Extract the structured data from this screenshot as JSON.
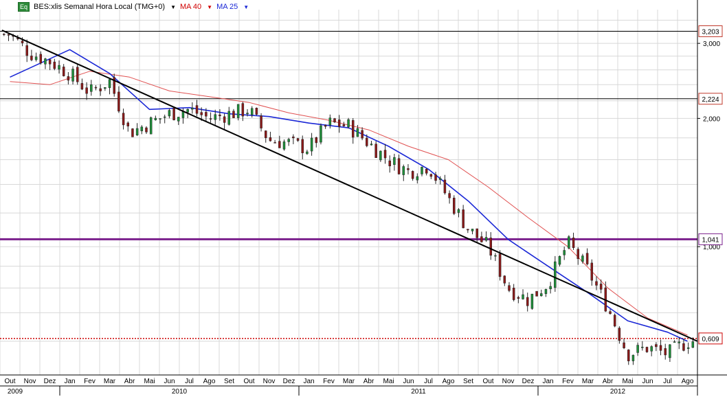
{
  "header": {
    "badge": "Eq",
    "symbol_label": "BES:xlis Semanal Hora Local (TMG+0)",
    "ma40_label": "MA 40",
    "ma25_label": "MA 25"
  },
  "colors": {
    "candle_up": "#1e8f3a",
    "candle_down": "#8b1a1a",
    "ma40": "#e05050",
    "ma25": "#1a27d6",
    "trendline": "#000000",
    "support_1041": "#7a1f8c",
    "support_0609": "#cc0000",
    "grid": "#d8d8d8"
  },
  "chart_data": {
    "type": "candlestick",
    "y_scale": "log",
    "ylim": [
      0.5,
      3.6
    ],
    "y_ticks": [
      "3,000",
      "2,000",
      "1,000"
    ],
    "x_months": [
      "Out",
      "Nov",
      "Dez",
      "Jan",
      "Fev",
      "Mar",
      "Abr",
      "Mai",
      "Jun",
      "Jul",
      "Ago",
      "Set",
      "Out",
      "Nov",
      "Dez",
      "Jan",
      "Fev",
      "Mar",
      "Abr",
      "Mai",
      "Jun",
      "Jul",
      "Ago",
      "Set",
      "Out",
      "Nov",
      "Dez",
      "Jan",
      "Fev",
      "Mar",
      "Abr",
      "Mai",
      "Jun",
      "Jul",
      "Ago"
    ],
    "x_years": [
      "2009",
      "2010",
      "2011",
      "2012"
    ],
    "year_start_month_index": [
      0,
      3,
      15,
      27
    ],
    "period": {
      "start": "2009-10",
      "end": "2012-08",
      "frequency": "weekly"
    },
    "horizontal_lines": [
      {
        "value": 3.203,
        "label": "3,203",
        "style": "solid",
        "color": "#000000"
      },
      {
        "value": 2.224,
        "label": "2,224",
        "style": "solid",
        "color": "#000000"
      },
      {
        "value": 1.041,
        "label": "1,041",
        "style": "solid-thick",
        "color": "#7a1f8c"
      },
      {
        "value": 0.609,
        "label": "0,609",
        "style": "dotted",
        "color": "#cc0000"
      }
    ],
    "trendline": {
      "from": {
        "date": "2009-10",
        "value": 3.22
      },
      "to": {
        "date": "2012-08",
        "value": 0.6
      }
    },
    "anchors": [
      [
        "2009-10",
        3.15
      ],
      [
        "2009-11",
        2.85
      ],
      [
        "2009-12",
        2.72
      ],
      [
        "2010-01",
        2.55
      ],
      [
        "2010-02",
        2.3
      ],
      [
        "2010-03",
        2.45
      ],
      [
        "2010-04",
        1.85
      ],
      [
        "2010-05",
        1.95
      ],
      [
        "2010-06",
        2.05
      ],
      [
        "2010-07",
        2.1
      ],
      [
        "2010-08",
        2.0
      ],
      [
        "2010-09",
        2.05
      ],
      [
        "2010-10",
        2.1
      ],
      [
        "2010-11",
        1.78
      ],
      [
        "2010-12",
        1.75
      ],
      [
        "2011-01",
        1.7
      ],
      [
        "2011-02",
        1.95
      ],
      [
        "2011-03",
        1.92
      ],
      [
        "2011-04",
        1.75
      ],
      [
        "2011-05",
        1.6
      ],
      [
        "2011-06",
        1.5
      ],
      [
        "2011-07",
        1.55
      ],
      [
        "2011-08",
        1.3
      ],
      [
        "2011-09",
        1.1
      ],
      [
        "2011-10",
        1.0
      ],
      [
        "2011-11",
        0.8
      ],
      [
        "2011-12",
        0.75
      ],
      [
        "2012-01",
        0.82
      ],
      [
        "2012-02",
        1.02
      ],
      [
        "2012-03",
        0.88
      ],
      [
        "2012-04",
        0.72
      ],
      [
        "2012-05",
        0.56
      ],
      [
        "2012-06",
        0.58
      ],
      [
        "2012-07",
        0.56
      ],
      [
        "2012-08",
        0.6
      ]
    ],
    "ma25_anchors": [
      [
        "2009-10",
        2.5
      ],
      [
        "2010-01",
        2.9
      ],
      [
        "2010-03",
        2.55
      ],
      [
        "2010-05",
        2.1
      ],
      [
        "2010-07",
        2.12
      ],
      [
        "2010-09",
        2.05
      ],
      [
        "2010-11",
        2.02
      ],
      [
        "2011-01",
        1.95
      ],
      [
        "2011-03",
        1.9
      ],
      [
        "2011-05",
        1.72
      ],
      [
        "2011-07",
        1.52
      ],
      [
        "2011-09",
        1.28
      ],
      [
        "2011-11",
        1.04
      ],
      [
        "2012-01",
        0.9
      ],
      [
        "2012-03",
        0.78
      ],
      [
        "2012-05",
        0.67
      ],
      [
        "2012-07",
        0.63
      ],
      [
        "2012-08",
        0.6
      ]
    ],
    "ma40_anchors": [
      [
        "2009-10",
        2.44
      ],
      [
        "2009-12",
        2.4
      ],
      [
        "2010-02",
        2.58
      ],
      [
        "2010-04",
        2.5
      ],
      [
        "2010-06",
        2.32
      ],
      [
        "2010-08",
        2.25
      ],
      [
        "2010-10",
        2.18
      ],
      [
        "2010-12",
        2.06
      ],
      [
        "2011-02",
        1.98
      ],
      [
        "2011-04",
        1.88
      ],
      [
        "2011-06",
        1.72
      ],
      [
        "2011-08",
        1.6
      ],
      [
        "2011-10",
        1.38
      ],
      [
        "2011-12",
        1.17
      ],
      [
        "2012-02",
        1.0
      ],
      [
        "2012-04",
        0.8
      ],
      [
        "2012-06",
        0.68
      ],
      [
        "2012-08",
        0.62
      ]
    ]
  }
}
